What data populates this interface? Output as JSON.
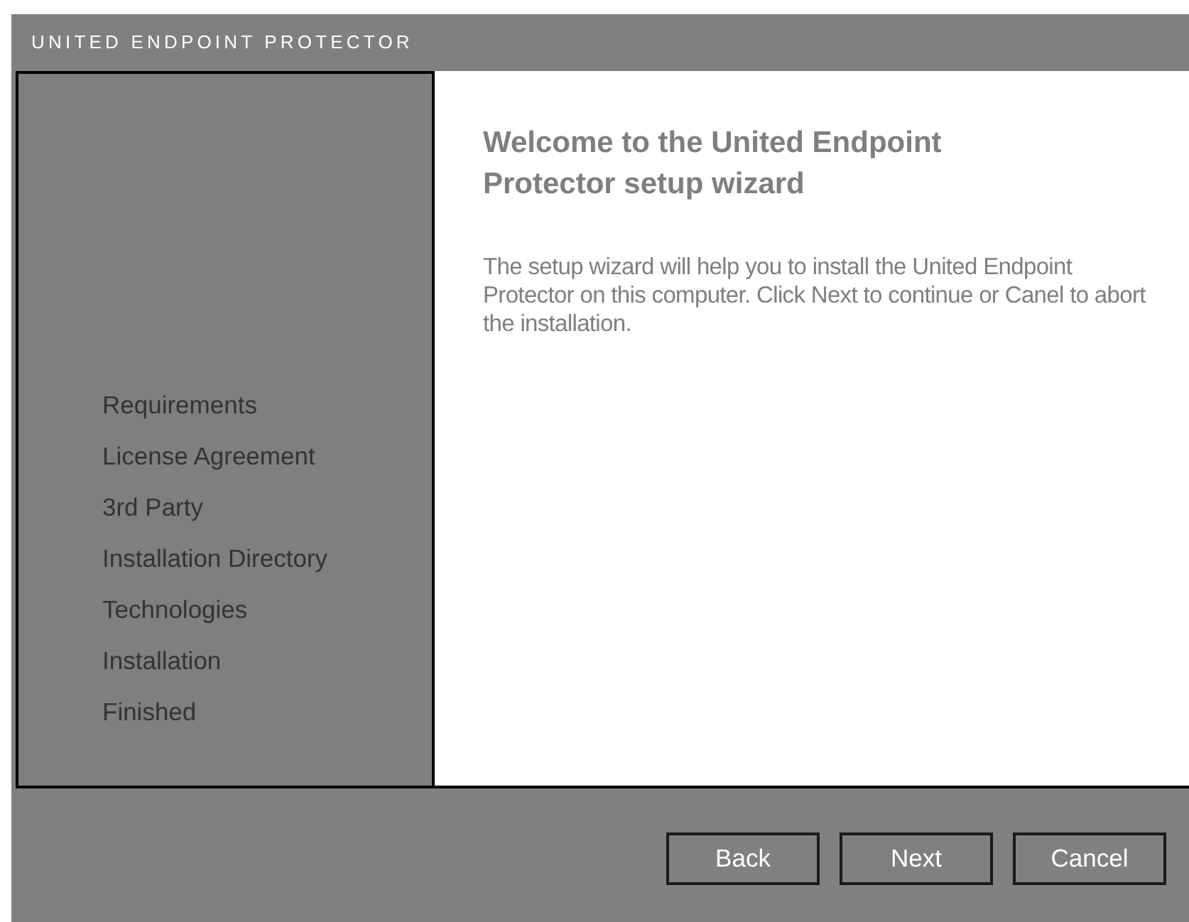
{
  "window": {
    "title": "UNITED ENDPOINT PROTECTOR"
  },
  "steps": [
    "Requirements",
    "License Agreement",
    "3rd Party",
    "Installation Directory",
    "Technologies",
    "Installation",
    "Finished"
  ],
  "content": {
    "heading": "Welcome to the United Endpoint Protector setup wizard",
    "body": "The setup wizard will help you to install the United Endpoint Protector on this computer. Click Next to continue or Canel to abort the installation."
  },
  "buttons": [
    "Back",
    "Next",
    "Cancel"
  ]
}
